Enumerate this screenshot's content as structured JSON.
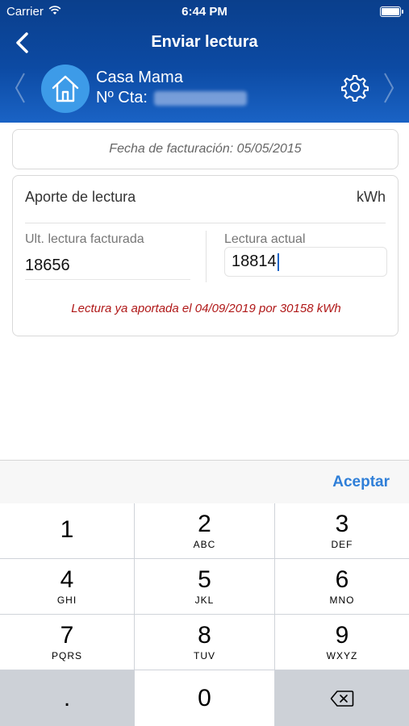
{
  "status_bar": {
    "carrier": "Carrier",
    "time": "6:44 PM"
  },
  "nav": {
    "title": "Enviar lectura"
  },
  "account": {
    "name": "Casa Mama",
    "number_label": "Nº Cta:"
  },
  "billing": {
    "date_text": "Fecha de facturación: 05/05/2015"
  },
  "reading": {
    "section_title": "Aporte de lectura",
    "unit": "kWh",
    "last_label": "Ult. lectura facturada",
    "last_value": "18656",
    "current_label": "Lectura actual",
    "current_value": "18814",
    "warning": "Lectura ya aportada el 04/09/2019 por 30158 kWh"
  },
  "keyboard": {
    "accept_label": "Aceptar",
    "keys": [
      {
        "digit": "1",
        "letters": ""
      },
      {
        "digit": "2",
        "letters": "ABC"
      },
      {
        "digit": "3",
        "letters": "DEF"
      },
      {
        "digit": "4",
        "letters": "GHI"
      },
      {
        "digit": "5",
        "letters": "JKL"
      },
      {
        "digit": "6",
        "letters": "MNO"
      },
      {
        "digit": "7",
        "letters": "PQRS"
      },
      {
        "digit": "8",
        "letters": "TUV"
      },
      {
        "digit": "9",
        "letters": "WXYZ"
      },
      {
        "digit": ".",
        "letters": ""
      },
      {
        "digit": "0",
        "letters": ""
      }
    ]
  },
  "colors": {
    "header_dark": "#0a3f8c",
    "header_light": "#1a63c5",
    "avatar": "#3d9be8",
    "warning": "#b01818",
    "accept": "#2f7fd8"
  }
}
